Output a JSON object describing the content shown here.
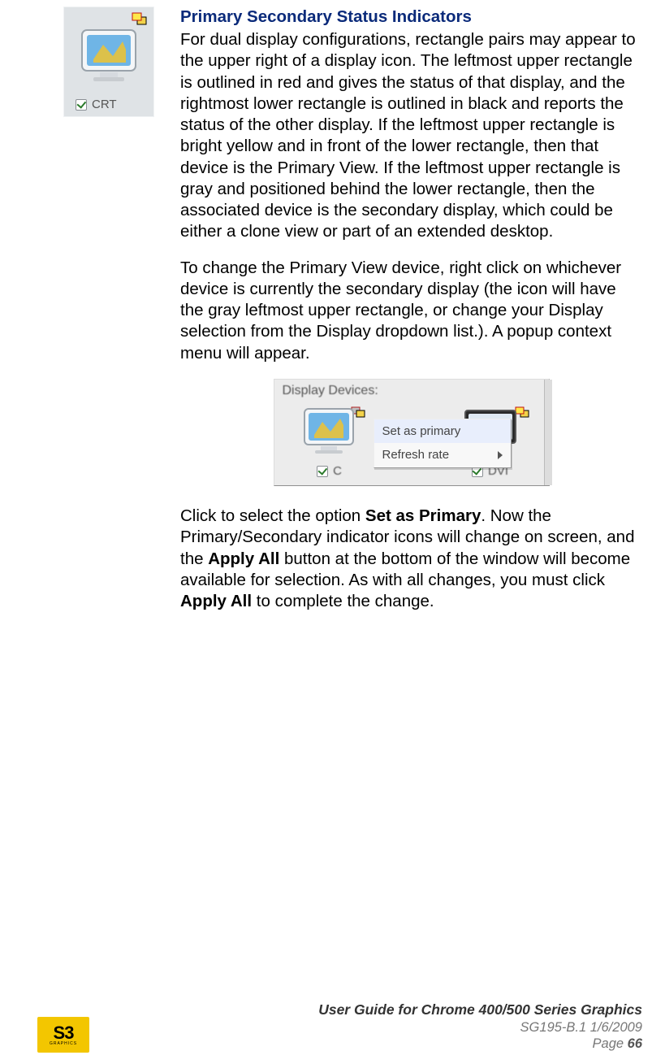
{
  "heading": "Primary Secondary Status Indicators",
  "para1": "For dual display configurations, rectangle pairs may appear to the upper right of a display icon. The leftmost upper rectangle is outlined in red and gives the status of that display, and the rightmost lower rectangle is outlined in black and reports the status of the other display. If the leftmost upper rectangle is bright yellow and in front of the lower rectangle, then that device is the Primary View. If the leftmost upper rectangle is gray and positioned behind the lower rectangle, then the associated device is the secondary display, which could be either a clone view or part of an extended desktop.",
  "para2": "To change the Primary View device, right click on whichever device is currently the secondary display (the icon will have the gray leftmost upper rectangle, or change your Display selection from the Display dropdown list.). A popup context menu will appear.",
  "para3a": "Click to select the option ",
  "para3b": "Set as Primary",
  "para3c": ". Now the Primary/Secondary indicator icons will change on screen, and the ",
  "para3d": "Apply All",
  "para3e": " button at the bottom of the window will become available for selection. As with all changes, you must click ",
  "para3f": "Apply All",
  "para3g": " to complete the change.",
  "crt": {
    "label": "CRT"
  },
  "panel": {
    "title": "Display Devices:",
    "dev1_label": "C",
    "dev2_label": "DVI",
    "menu": {
      "item1": "Set as primary",
      "item2": "Refresh rate"
    }
  },
  "footer": {
    "logo": "S3",
    "logo_sub": "GRAPHICS",
    "line1": "User Guide for Chrome 400/500 Series Graphics",
    "line2": "SG195-B.1   1/6/2009",
    "line3a": "Page ",
    "line3b": "66"
  }
}
